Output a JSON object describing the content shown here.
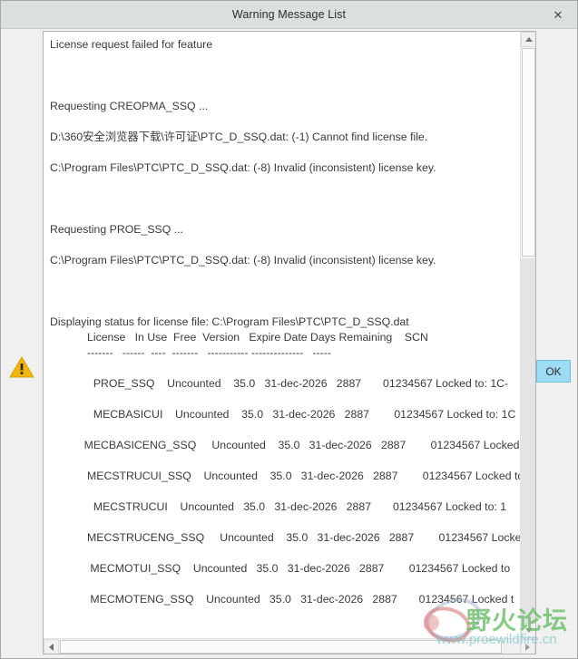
{
  "window": {
    "title": "Warning Message List",
    "close_label": "✕"
  },
  "buttons": {
    "ok_label": "OK"
  },
  "icons": {
    "warning": "warning-triangle",
    "close": "close-x"
  },
  "message": {
    "lines": [
      "License request failed for feature",
      "",
      "",
      "",
      "Requesting CREOPMA_SSQ ...",
      "",
      "D:\\360安全浏览器下载\\许可证\\PTC_D_SSQ.dat: (-1) Cannot find license file.",
      "",
      "C:\\Program Files\\PTC\\PTC_D_SSQ.dat: (-8) Invalid (inconsistent) license key.",
      "",
      "",
      "",
      "Requesting PROE_SSQ ...",
      "",
      "C:\\Program Files\\PTC\\PTC_D_SSQ.dat: (-8) Invalid (inconsistent) license key.",
      "",
      "",
      "",
      "Displaying status for license file: C:\\Program Files\\PTC\\PTC_D_SSQ.dat"
    ],
    "header_row": "            License   In Use  Free  Version   Expire Date Days Remaining    SCN",
    "divider_row": "            -------   ------  ----  -------   ----------- --------------   -----",
    "table_rows": [
      "              PROE_SSQ    Uncounted    35.0   31-dec-2026   2887       01234567 Locked to: 1C-",
      "              MECBASICUI    Uncounted    35.0   31-dec-2026   2887        01234567 Locked to: 1C",
      "           MECBASICENG_SSQ     Uncounted    35.0   31-dec-2026   2887        01234567 Locked t",
      "            MECSTRUCUI_SSQ    Uncounted    35.0   31-dec-2026   2887        01234567 Locked to",
      "              MECSTRUCUI    Uncounted   35.0   31-dec-2026   2887       01234567 Locked to: 1",
      "            MECSTRUCENG_SSQ     Uncounted    35.0   31-dec-2026   2887        01234567 Locked",
      "             MECMOTUI_SSQ    Uncounted   35.0   31-dec-2026   2887        01234567 Locked to",
      "             MECMOTENG_SSQ    Uncounted   35.0   31-dec-2026   2887       01234567 Locked t"
    ]
  },
  "watermark": {
    "text_cn": "野火论坛",
    "url": "www.proewildfire.cn"
  },
  "colors": {
    "titlebar": "#dcdfe0",
    "body": "#f0f0f0",
    "panel": "#ffffff",
    "text": "#3a3a3a",
    "warning_icon": "#f2b705",
    "ok_button": "#9ddcf4",
    "watermark_green": "#6cbe6a",
    "watermark_cyan": "#78c8cd"
  }
}
